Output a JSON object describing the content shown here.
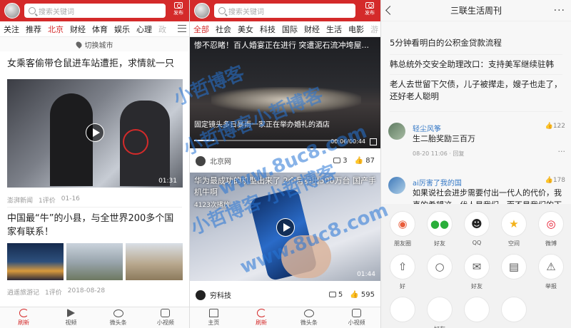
{
  "panel1": {
    "search_placeholder": "搜索关键词",
    "publish_label": "发布",
    "channels": [
      "关注",
      "推荐",
      "北京",
      "财经",
      "体育",
      "娱乐",
      "心理",
      "政"
    ],
    "active_channel": "北京",
    "city_switch": "切换城市",
    "articles": [
      {
        "title": "女乘客偷带仓鼠进车站遭拒，求情就一只",
        "source": "澎湃新闻",
        "comments": "1评价",
        "date": "01-16",
        "duration": "01:31"
      },
      {
        "title": "中国最“牛”的小县，与全世界200多个国家有联系！",
        "source": "逍遥旅游记",
        "comments": "1评价",
        "date": "2018-08-28"
      }
    ],
    "nav": [
      "刷新",
      "视频",
      "微头条",
      "小视频"
    ],
    "nav_active": "刷新"
  },
  "panel2": {
    "search_placeholder": "搜索关键词",
    "publish_label": "发布",
    "channels": [
      "全部",
      "社会",
      "美女",
      "科技",
      "国际",
      "财经",
      "生活",
      "电影",
      "游"
    ],
    "active_channel": "全部",
    "video1": {
      "title": "惨不忍睹！百人婚宴正在进行 突遭泥石流冲垮屋...",
      "caption": "固定镜头多日暴雨一家正在举办婚礼的酒店",
      "timestamp": "00:06/00:44",
      "source": "北京网",
      "comments": "3",
      "likes": "87"
    },
    "video2": {
      "title": "华为最成功的机型出来了 2个月卖出500万台 国产手机牛啊",
      "plays": "4123次播放",
      "duration": "01:44",
      "source": "穷科技",
      "comments": "5",
      "likes": "595"
    },
    "nav": [
      "主页",
      "刷新",
      "微头条",
      "小视频"
    ],
    "nav_active": "刷新"
  },
  "panel3": {
    "title": "三联生活周刊",
    "related": [
      "5分钟看明白的公积金贷款流程",
      "韩总统外交安全助理改口：支持美军继续驻韩",
      "老人去世留下欠债，儿子被撵走，嫂子也走了，还好老人聪明"
    ],
    "comments": [
      {
        "name": "轻尘风筝",
        "likes": "122",
        "text": "生二胎奖励三百万",
        "meta": "08-20 11:06 · 回复"
      },
      {
        "name": "ai厉害了我的国",
        "likes": "178",
        "text": "如果说社会进步需要付出一代人的代价，我喜的希望这一代人是我们，而不是我们的下"
      }
    ],
    "share_row1": [
      "朋友圈",
      "好友",
      "QQ",
      "空间",
      "微博"
    ],
    "share_row2": [
      "好",
      "",
      "好友",
      "",
      "举报"
    ],
    "share_row3": [
      "",
      "好友",
      "",
      "",
      ""
    ]
  },
  "watermarks": [
    "小哲博客",
    "小哲博客小哲博客",
    "www.8uc8.com",
    "小哲博客 小哲博客",
    "www.8uc8.com"
  ]
}
